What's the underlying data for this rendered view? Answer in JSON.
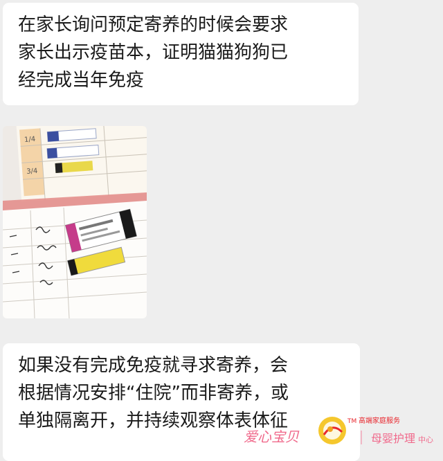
{
  "messages": [
    {
      "lines": [
        "在家长询问预定寄养的时候会要求",
        "家长出示疫苗本，证明猫猫狗狗已",
        "经完成当年免疫"
      ]
    },
    {
      "lines": [
        "如果没有完成免疫就寻求寄养，会",
        "根据情况安排“住院”而非寄养，或",
        "单独隔离开，并持续观察体表体征"
      ]
    }
  ],
  "watermark": {
    "brand": "爱心宝贝",
    "tm": "TM",
    "tagline": "高端家庭服务",
    "service": "母婴护理",
    "service_suffix": "中心"
  },
  "colors": {
    "bubble_bg": "#ffffff",
    "chat_bg": "#eeeeee",
    "brand_pink": "#f06a8c",
    "brand_red": "#e8262d",
    "logo_yellow": "#f4c116"
  },
  "icons": {
    "logo": "heart-swirl-logo-icon"
  }
}
